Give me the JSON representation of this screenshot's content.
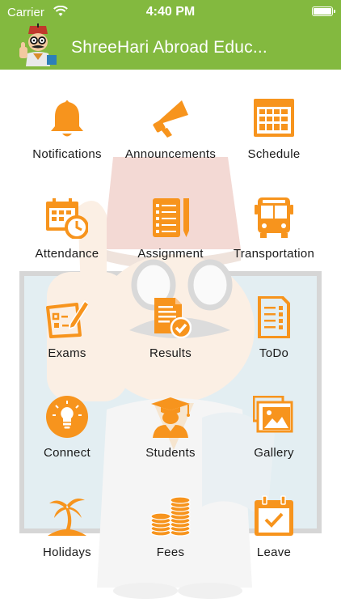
{
  "status_bar": {
    "carrier": "Carrier",
    "time": "4:40 PM"
  },
  "header": {
    "title": "ShreeHari Abroad Educ..."
  },
  "colors": {
    "header_green": "#83b93f",
    "icon_orange": "#f7941d"
  },
  "menu": [
    {
      "label": "Notifications",
      "icon": "bell-icon"
    },
    {
      "label": "Announcements",
      "icon": "megaphone-icon"
    },
    {
      "label": "Schedule",
      "icon": "calendar-grid-icon"
    },
    {
      "label": "Attendance",
      "icon": "calendar-clock-icon"
    },
    {
      "label": "Assignment",
      "icon": "notepad-list-icon"
    },
    {
      "label": "Transportation",
      "icon": "bus-icon"
    },
    {
      "label": "Exams",
      "icon": "exam-pencil-icon"
    },
    {
      "label": "Results",
      "icon": "document-check-icon"
    },
    {
      "label": "ToDo",
      "icon": "todo-list-icon"
    },
    {
      "label": "Connect",
      "icon": "lightbulb-icon"
    },
    {
      "label": "Students",
      "icon": "graduate-icon"
    },
    {
      "label": "Gallery",
      "icon": "gallery-icon"
    },
    {
      "label": "Holidays",
      "icon": "palm-tree-icon"
    },
    {
      "label": "Fees",
      "icon": "coins-icon"
    },
    {
      "label": "Leave",
      "icon": "calendar-check-icon"
    }
  ]
}
